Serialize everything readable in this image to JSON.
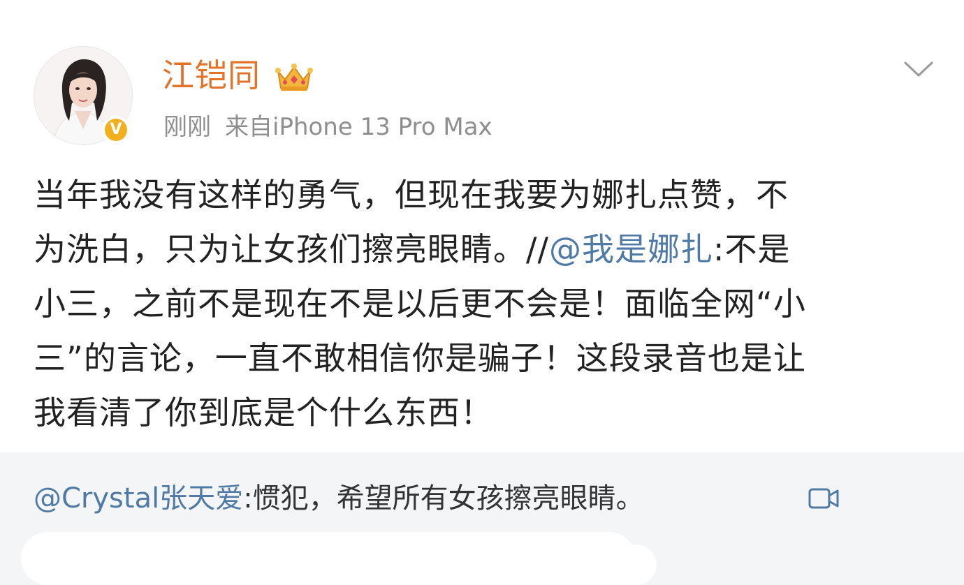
{
  "post": {
    "author": {
      "name": "江铠同",
      "verified_badge": "V",
      "avatar_icon": "avatar-portrait",
      "crown_icon": "crown-icon"
    },
    "time": "刚刚",
    "source": "来自iPhone 13 Pro Max",
    "menu_icon": "chevron-down-icon",
    "text": {
      "line1": "当年我没有这样的勇气，但现在我要为娜扎点赞，不",
      "line2_a": "为洗白，只为让女孩们擦亮眼睛。//",
      "line2_mention": "@我是娜扎",
      "line2_b": ":不是",
      "line3": "小三，之前不是现在不是以后更不会是！面临全网“小",
      "line4": "三”的言论，一直不敢相信你是骗子！这段录音也是让",
      "line5": "我看清了你到底是个什么东西！"
    }
  },
  "repost": {
    "mention": "@Crystal张天爱",
    "text": ":惯犯，希望所有女孩擦亮眼睛。",
    "video_icon": "video-icon"
  },
  "colors": {
    "username": "#e3732a",
    "mention": "#4f7aa6",
    "meta": "#8e8e8e",
    "verified": "#f2b01e",
    "repost_bg": "#f4f5f7"
  }
}
